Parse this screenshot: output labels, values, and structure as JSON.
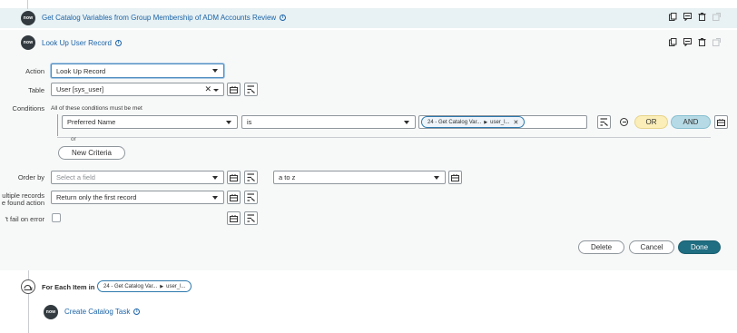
{
  "steps": {
    "top": {
      "logo": "now",
      "title": "Get Catalog Variables from Group Membership of ADM Accounts Review"
    },
    "current": {
      "logo": "now",
      "title": "Look Up User Record"
    },
    "for_each": {
      "label": "For Each Item in",
      "pill_left": "24 - Get Catalog Var...",
      "pill_right": "user_l..."
    },
    "child": {
      "logo": "now",
      "title": "Create Catalog Task"
    }
  },
  "form": {
    "action": {
      "label": "Action",
      "value": "Look Up Record"
    },
    "table": {
      "label": "Table",
      "value": "User [sys_user]"
    },
    "conditions": {
      "label": "Conditions",
      "hint": "All of these conditions must be met",
      "field": "Preferred Name",
      "operator": "is",
      "pill_left": "24 - Get Catalog Var...",
      "pill_right": "user_l...",
      "or_button": "OR",
      "and_button": "AND",
      "or_separator": "or",
      "new_criteria": "New Criteria"
    },
    "order_by": {
      "label": "Order by",
      "placeholder": "Select a field",
      "direction": "a to z"
    },
    "multiple_records": {
      "label_line1": "ultiple records",
      "label_line2": "e found action",
      "value": "Return only the first record"
    },
    "dont_fail": {
      "label": "'t fail on error"
    }
  },
  "buttons": {
    "delete": "Delete",
    "cancel": "Cancel",
    "done": "Done"
  },
  "colors": {
    "accent": "#1b64a8",
    "done_bg": "#1f6e82",
    "or_bg": "#fbeeb8",
    "and_bg": "#b7dbe6",
    "header_bg": "#e9f2f4"
  }
}
